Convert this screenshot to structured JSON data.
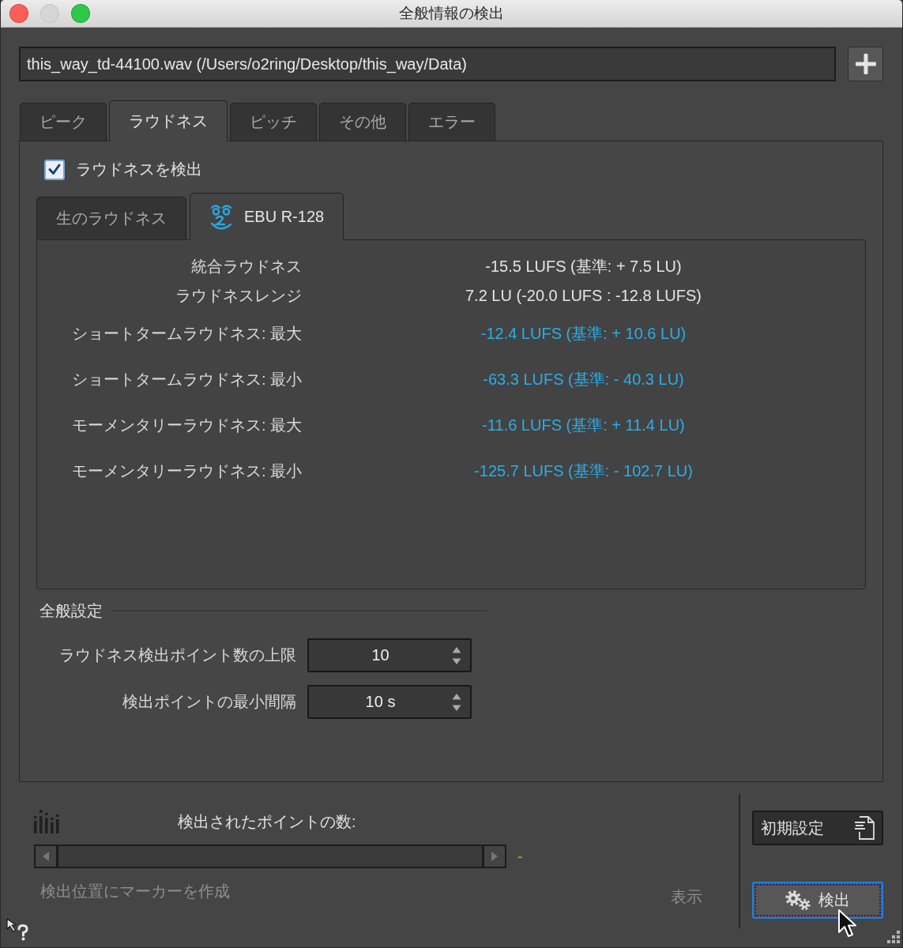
{
  "window": {
    "title": "全般情報の検出",
    "buttons": [
      {
        "kind": "close",
        "disabled": false
      },
      {
        "kind": "minimize",
        "disabled": true
      },
      {
        "kind": "zoom",
        "disabled": false
      }
    ]
  },
  "file_field": {
    "value": "this_way_td-44100.wav (/Users/o2ring/Desktop/this_way/Data)"
  },
  "tabs": [
    {
      "label": "ピーク",
      "selected": false
    },
    {
      "label": "ラウドネス",
      "selected": true
    },
    {
      "label": "ピッチ",
      "selected": false
    },
    {
      "label": "その他",
      "selected": false
    },
    {
      "label": "エラー",
      "selected": false
    }
  ],
  "detect_checkbox": {
    "label": "ラウドネスを検出",
    "checked": true
  },
  "sub_tabs": [
    {
      "kind": "text",
      "label": "生のラウドネス",
      "selected": false
    },
    {
      "kind": "logo",
      "label": "EBU R-128",
      "selected": true
    }
  ],
  "results": [
    {
      "kind": "summary",
      "label": "統合ラウドネス",
      "value": "-15.5 LUFS (基準: + 7.5 LU)"
    },
    {
      "kind": "summary",
      "label": "ラウドネスレンジ",
      "value": "7.2 LU (-20.0 LUFS : -12.8 LUFS)"
    },
    {
      "kind": "detail",
      "label": "ショートタームラウドネス: 最大",
      "value": "-12.4 LUFS (基準: + 10.6 LU)"
    },
    {
      "kind": "detail",
      "label": "ショートタームラウドネス: 最小",
      "value": "-63.3 LUFS (基準: - 40.3 LU)"
    },
    {
      "kind": "detail",
      "label": "モーメンタリーラウドネス: 最大",
      "value": "-11.6 LUFS (基準: + 11.4 LU)"
    },
    {
      "kind": "detail",
      "label": "モーメンタリーラウドネス: 最小",
      "value": "-125.7 LUFS (基準: - 102.7 LU)"
    }
  ],
  "general_settings": {
    "title": "全般設定",
    "fields": [
      {
        "label": "ラウドネス検出ポイント数の上限",
        "value": "10"
      },
      {
        "label": "検出ポイントの最小間隔",
        "value": "10 s"
      }
    ]
  },
  "detected_points": {
    "label": "検出されたポイントの数:",
    "count": "-"
  },
  "marker_option": {
    "label": "検出位置にマーカーを作成",
    "disabled": true
  },
  "show_button": {
    "label": "表示",
    "disabled": true
  },
  "buttons": [
    {
      "kind": "defaults",
      "label": "初期設定",
      "focused": false
    },
    {
      "kind": "detect",
      "label": "検出",
      "focused": true
    }
  ]
}
